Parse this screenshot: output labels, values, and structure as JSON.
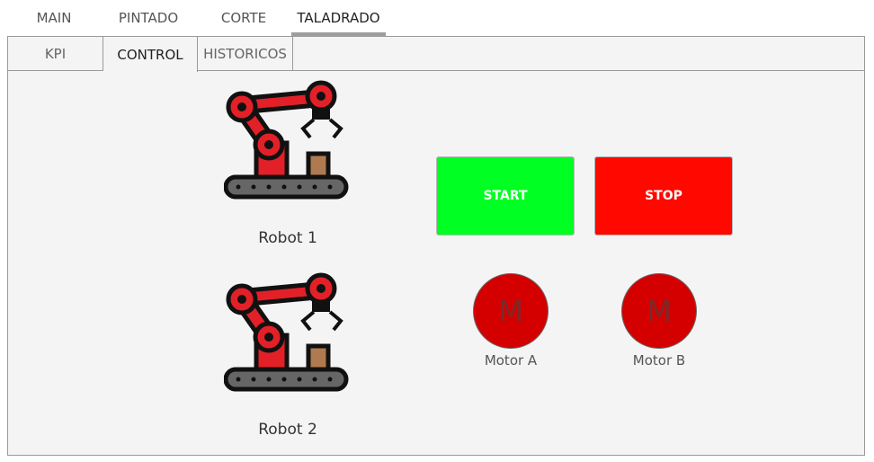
{
  "top_tabs": [
    {
      "label": "MAIN",
      "active": false
    },
    {
      "label": "PINTADO",
      "active": false
    },
    {
      "label": "CORTE",
      "active": false
    },
    {
      "label": "TALADRADO",
      "active": true
    }
  ],
  "sub_tabs": [
    {
      "label": "KPI",
      "active": false
    },
    {
      "label": "CONTROL",
      "active": true
    },
    {
      "label": "HISTORICOS",
      "active": false
    }
  ],
  "robots": [
    {
      "label": "Robot 1",
      "icon": "robot-arm-icon"
    },
    {
      "label": "Robot 2",
      "icon": "robot-arm-icon"
    }
  ],
  "buttons": {
    "start": {
      "label": "START",
      "color": "#00ff22"
    },
    "stop": {
      "label": "STOP",
      "color": "#ff0800"
    }
  },
  "motors": [
    {
      "symbol": "M",
      "label": "Motor A",
      "color": "#d40000"
    },
    {
      "symbol": "M",
      "label": "Motor B",
      "color": "#d40000"
    }
  ]
}
